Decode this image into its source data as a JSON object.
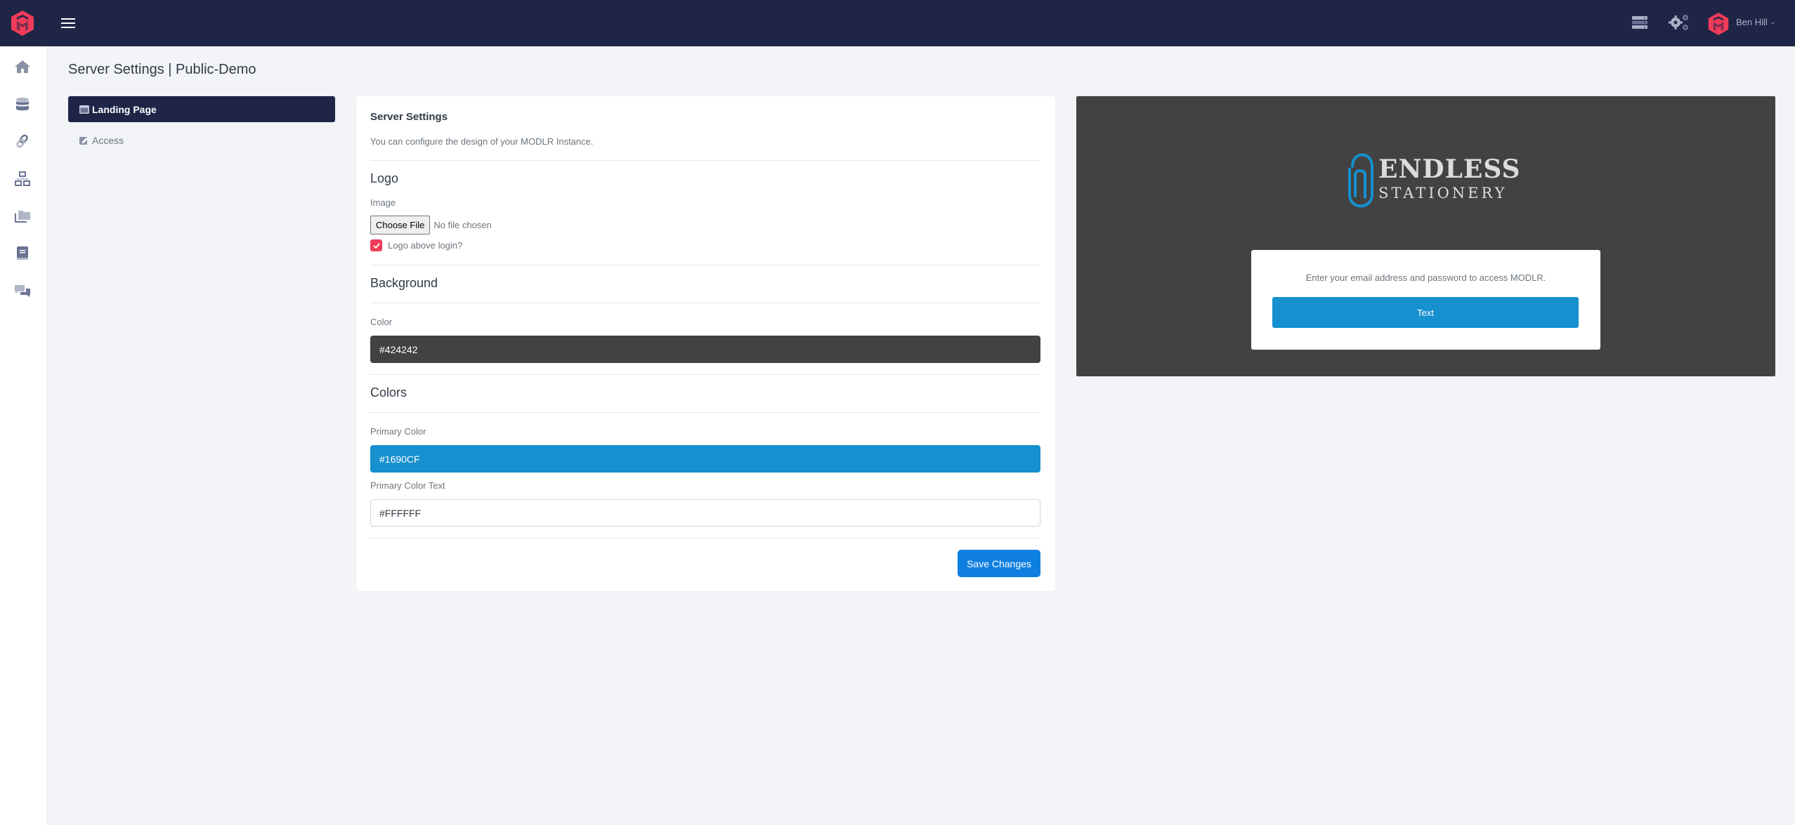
{
  "topbar": {
    "user_name": "Ben Hill",
    "icons": [
      "modlr-logo-icon",
      "hamburger-menu-icon",
      "server-icon",
      "gears-icon",
      "user-avatar-icon",
      "chevron-down-icon"
    ]
  },
  "leftnav": {
    "items": [
      {
        "icon": "home-icon"
      },
      {
        "icon": "database-icon"
      },
      {
        "icon": "link-icon"
      },
      {
        "icon": "sitemap-icon"
      },
      {
        "icon": "folders-icon"
      },
      {
        "icon": "book-icon"
      },
      {
        "icon": "comments-icon"
      }
    ]
  },
  "page": {
    "title": "Server Settings | Public-Demo"
  },
  "settings_menu": {
    "items": [
      {
        "label": "Landing Page",
        "icon": "window-icon",
        "active": true
      },
      {
        "label": "Access",
        "icon": "edit-square-icon",
        "active": false
      }
    ]
  },
  "form": {
    "title": "Server Settings",
    "description": "You can configure the design of your MODLR Instance.",
    "logo": {
      "section_title": "Logo",
      "image_label": "Image",
      "choose_file_label": "Choose File",
      "no_file_text": "No file chosen",
      "logo_above_login_label": "Logo above login?",
      "logo_above_login_checked": true
    },
    "background": {
      "section_title": "Background",
      "color_label": "Color",
      "color_value": "#424242"
    },
    "colors": {
      "section_title": "Colors",
      "primary_color_label": "Primary Color",
      "primary_color_value": "#1690CF",
      "primary_color_text_label": "Primary Color Text",
      "primary_color_text_value": "#FFFFFF"
    },
    "save_label": "Save Changes"
  },
  "preview": {
    "background_color": "#424242",
    "logo_line1": "ENDLESS",
    "logo_line2": "STATIONERY",
    "login_text": "Enter your email address and password to access MODLR.",
    "button_label": "Text",
    "button_color": "#1690CF",
    "button_text_color": "#FFFFFF"
  },
  "colors": {
    "topbar": "#1f2547",
    "accent_red": "#f03c5a",
    "save_button": "#0e7fe1"
  }
}
